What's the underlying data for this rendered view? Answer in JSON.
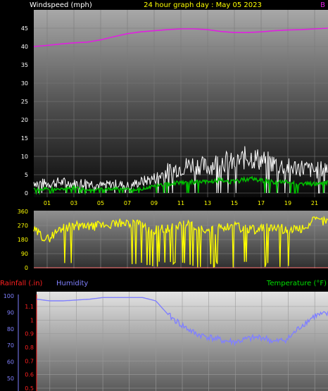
{
  "chart_data": [
    {
      "type": "line",
      "title": "24 hour graph day : May 05 2023",
      "ylabel": "Windspeed (mph)",
      "secondary_label": "B",
      "ylim": [
        0,
        45
      ],
      "yticks": [
        0,
        5,
        10,
        15,
        20,
        25,
        30,
        35,
        40,
        45
      ],
      "xticks": [
        "01",
        "03",
        "05",
        "07",
        "09",
        "11",
        "13",
        "15",
        "17",
        "19",
        "21"
      ],
      "grid": true,
      "colors": {
        "barometer": "#e020e0",
        "gust": "#ffffff",
        "wind": "#00c000",
        "axis_text": "#ffffff",
        "title": "#ffff00"
      },
      "series": [
        {
          "x": [
            0,
            1,
            2,
            3,
            4,
            5,
            6,
            7,
            8,
            9,
            10,
            11,
            12,
            13,
            14,
            15,
            16,
            17,
            18,
            19,
            20,
            21,
            22
          ],
          "values": [
            40,
            40.3,
            40.7,
            41,
            41.2,
            41.8,
            42.7,
            43.5,
            44,
            44.3,
            44.6,
            44.8,
            44.8,
            44.6,
            44.1,
            43.8,
            43.8,
            44,
            44.3,
            44.5,
            44.6,
            44.8,
            45
          ]
        },
        {
          "x": [
            0,
            1,
            2,
            3,
            4,
            5,
            6,
            7,
            8,
            9,
            10,
            11,
            12,
            13,
            14,
            15,
            16,
            17,
            18,
            19,
            20,
            21,
            22
          ],
          "values": [
            3,
            2.5,
            3,
            2.5,
            3,
            2,
            2.5,
            2,
            3,
            4,
            6,
            7,
            8,
            7,
            9,
            8,
            10,
            9,
            8,
            7,
            7,
            6,
            7
          ]
        },
        {
          "x": [
            0,
            1,
            2,
            3,
            4,
            5,
            6,
            7,
            8,
            9,
            10,
            11,
            12,
            13,
            14,
            15,
            16,
            17,
            18,
            19,
            20,
            21,
            22
          ],
          "values": [
            1,
            1.2,
            1,
            1.5,
            1,
            1,
            1.2,
            1,
            1,
            2,
            2.5,
            3,
            3,
            3,
            3.5,
            3,
            4,
            3.5,
            3,
            3,
            2.5,
            2.5,
            3
          ]
        }
      ]
    },
    {
      "type": "line",
      "ylim": [
        0,
        360
      ],
      "yticks": [
        0,
        90,
        180,
        270,
        360
      ],
      "colors": {
        "direction": "#ffff00",
        "tick_text": "#ffff00"
      },
      "series": [
        {
          "x": [
            0,
            1,
            2,
            3,
            4,
            5,
            6,
            7,
            8,
            9,
            10,
            11,
            12,
            13,
            14,
            15,
            16,
            17,
            18,
            19,
            20,
            21,
            22
          ],
          "values": [
            240,
            180,
            250,
            270,
            260,
            270,
            280,
            290,
            270,
            240,
            250,
            280,
            270,
            220,
            260,
            270,
            240,
            250,
            260,
            240,
            250,
            300,
            300
          ]
        }
      ]
    },
    {
      "type": "line",
      "legend": [
        "Rainfall (.in)",
        "Humidity",
        "Temperature (°F)"
      ],
      "colors": {
        "rainfall": "#ff2020",
        "humidity": "#8080ff",
        "temperature": "#00e000"
      },
      "humidity_axis": {
        "ylim": [
          50,
          100
        ],
        "yticks": [
          50,
          60,
          70,
          80,
          90,
          100
        ]
      },
      "rainfall_axis": {
        "ylim": [
          0.5,
          1.1
        ],
        "yticks": [
          "0.5",
          "0.6",
          "0.7",
          "0.8",
          "0.9",
          "1",
          "1.1"
        ]
      },
      "series": [
        {
          "x": [
            0,
            1,
            2,
            3,
            4,
            5,
            6,
            7,
            8,
            9,
            10,
            11,
            12,
            13,
            14,
            15,
            16,
            17,
            18,
            19,
            20,
            21,
            22
          ],
          "values": [
            98,
            97,
            97,
            97.5,
            98,
            99,
            99,
            99,
            99,
            97,
            88,
            82,
            77,
            75,
            73,
            72,
            74,
            75,
            72,
            74,
            82,
            88,
            89
          ]
        }
      ]
    }
  ]
}
